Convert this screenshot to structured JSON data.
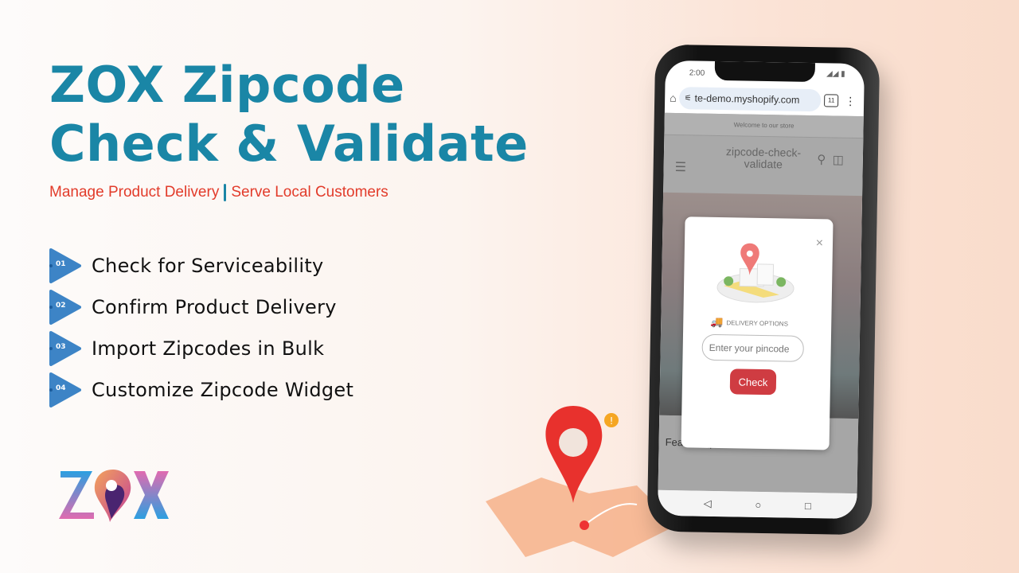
{
  "headline": {
    "line1": "ZOX Zipcode",
    "line2": "Check & Validate"
  },
  "subtitle": {
    "left": "Manage Product Delivery",
    "right": "Serve Local Customers"
  },
  "features": [
    {
      "num": "01",
      "label": "Check for Serviceability"
    },
    {
      "num": "02",
      "label": "Confirm Product Delivery"
    },
    {
      "num": "03",
      "label": "Import Zipcodes in Bulk"
    },
    {
      "num": "04",
      "label": "Customize Zipcode Widget"
    }
  ],
  "logo": {
    "text": "ZOX"
  },
  "colors": {
    "brand": "#1a86a6",
    "accent": "#e23b2a",
    "check_button": "#cf3c42"
  },
  "phone": {
    "time": "2:00",
    "url": "te-demo.myshopify.com",
    "tab_count": "11",
    "welcome": "Welcome to our store",
    "store_name": "zipcode-check-validate",
    "featured": "Featured products",
    "modal": {
      "delivery_label": "DELIVERY OPTIONS",
      "pincode_placeholder": "Enter your pincode",
      "check_label": "Check",
      "close": "×"
    }
  }
}
